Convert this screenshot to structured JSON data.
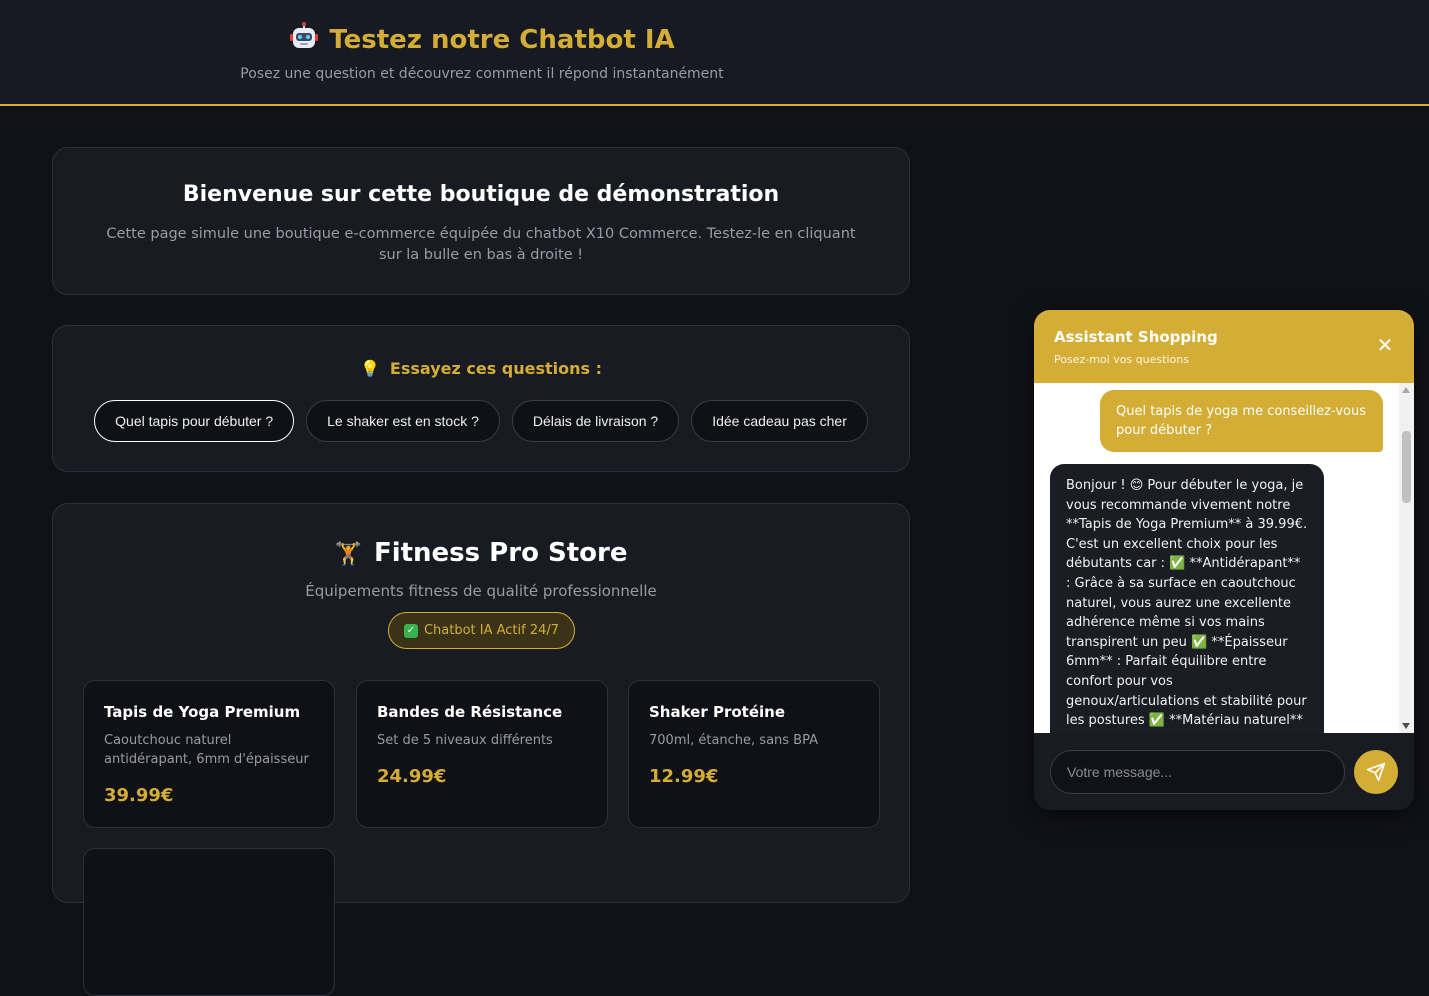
{
  "header": {
    "title": "Testez notre Chatbot IA",
    "subtitle": "Posez une question et découvrez comment il répond instantanément",
    "icon": "robot-icon"
  },
  "welcome": {
    "title": "Bienvenue sur cette boutique de démonstration",
    "text": "Cette page simule une boutique e-commerce équipée du chatbot X10 Commerce. Testez-le en cliquant sur la bulle en bas à droite !"
  },
  "questions": {
    "title": "Essayez ces questions :",
    "icon": "lightbulb-icon",
    "items": [
      "Quel tapis pour débuter ?",
      "Le shaker est en stock ?",
      "Délais de livraison ?",
      "Idée cadeau pas cher"
    ]
  },
  "store": {
    "title": "Fitness Pro Store",
    "icon": "dumbbell-icon",
    "subtitle": "Équipements fitness de qualité professionnelle",
    "badge": "Chatbot IA Actif 24/7",
    "products": [
      {
        "name": "Tapis de Yoga Premium",
        "desc": "Caoutchouc naturel antidérapant, 6mm d'épaisseur",
        "price": "39.99€"
      },
      {
        "name": "Bandes de Résistance",
        "desc": "Set de 5 niveaux différents",
        "price": "24.99€"
      },
      {
        "name": "Shaker Protéine",
        "desc": "700ml, étanche, sans BPA",
        "price": "12.99€"
      }
    ]
  },
  "chat": {
    "title": "Assistant Shopping",
    "subtitle": "Posez-moi vos questions",
    "user_message": "Quel tapis de yoga me conseillez-vous pour débuter ?",
    "bot_message": "Bonjour ! 😊 Pour débuter le yoga, je vous recommande vivement notre **Tapis de Yoga Premium** à 39.99€. C'est un excellent choix pour les débutants car : ✅ **Antidérapant** : Grâce à sa surface en caoutchouc naturel, vous aurez une excellente adhérence même si vos mains transpirent un peu ✅ **Épaisseur 6mm** : Parfait équilibre entre confort pour vos genoux/articulations et stabilité pour les postures ✅ **Matériau naturel** : Le caoutchouc",
    "input_placeholder": "Votre message..."
  },
  "colors": {
    "accent": "#d4ad37",
    "background": "#111218",
    "card": "#191b23"
  }
}
